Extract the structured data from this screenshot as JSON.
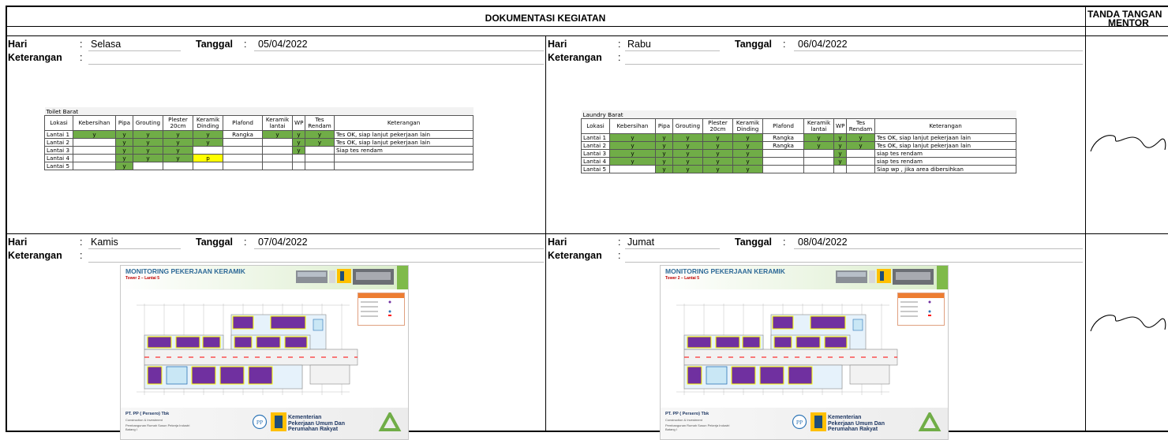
{
  "header": {
    "dokumentasi": "DOKUMENTASI KEGIATAN",
    "tanda_tangan": "TANDA TANGAN",
    "mentor": "MENTOR"
  },
  "labels": {
    "hari": "Hari",
    "tanggal": "Tanggal",
    "keterangan": "Keterangan",
    "colon": ":"
  },
  "entries": [
    {
      "hari": "Selasa",
      "tanggal": "05/04/2022"
    },
    {
      "hari": "Rabu",
      "tanggal": "06/04/2022"
    },
    {
      "hari": "Kamis",
      "tanggal": "07/04/2022"
    },
    {
      "hari": "Jumat",
      "tanggal": "08/04/2022"
    }
  ],
  "table_headers": [
    "Lokasi",
    "Kebersihan",
    "Pipa",
    "Grouting",
    "Plester 20cm",
    "Keramik Dinding",
    "Plafond",
    "Keramik lantai",
    "WP",
    "Tes Rendam",
    "Keterangan"
  ],
  "table1": {
    "title": "Toilet Barat",
    "rows": [
      {
        "cells": [
          "Lantai 1",
          "y",
          "y",
          "y",
          "y",
          "y",
          "Rangka",
          "y",
          "y",
          "y",
          "Tes OK, siap lanjut pekerjaan lain"
        ]
      },
      {
        "cells": [
          "Lantai 2",
          "",
          "y",
          "y",
          "y",
          "y",
          "",
          "",
          "y",
          "y",
          "Tes OK, siap lanjut pekerjaan lain"
        ]
      },
      {
        "cells": [
          "Lantai 3",
          "",
          "y",
          "y",
          "y",
          "",
          "",
          "",
          "y",
          "",
          "Siap tes rendam"
        ]
      },
      {
        "cells": [
          "Lantai 4",
          "",
          "y",
          "y",
          "y",
          "p",
          "",
          "",
          "",
          "",
          ""
        ]
      },
      {
        "cells": [
          "Lantai 5",
          "",
          "y",
          "",
          "",
          "",
          "",
          "",
          "",
          "",
          ""
        ]
      }
    ]
  },
  "table2": {
    "title": "Laundry Barat",
    "rows": [
      {
        "cells": [
          "Lantai 1",
          "y",
          "y",
          "y",
          "y",
          "y",
          "Rangka",
          "y",
          "y",
          "y",
          "Tes OK, siap lanjut pekerjaan lain"
        ]
      },
      {
        "cells": [
          "Lantai 2",
          "y",
          "y",
          "y",
          "y",
          "y",
          "Rangka",
          "y",
          "y",
          "y",
          "Tes OK, siap lanjut pekerjaan lain"
        ]
      },
      {
        "cells": [
          "Lantai 3",
          "y",
          "y",
          "y",
          "y",
          "y",
          "",
          "",
          "y",
          "",
          "siap tes rendam"
        ]
      },
      {
        "cells": [
          "Lantai 4",
          "y",
          "y",
          "y",
          "y",
          "y",
          "",
          "",
          "y",
          "",
          "siap tes rendam"
        ]
      },
      {
        "cells": [
          "Lantai 5",
          "",
          "y",
          "y",
          "y",
          "y",
          "",
          "",
          "",
          "",
          "Siap wp , jika area dibersihkan"
        ]
      }
    ]
  },
  "monitoring": {
    "title": "MONITORING PEKERJAAN KERAMIK",
    "subtitle": "Tower 2 – Lantai 5",
    "company": "PT. PP ( Persero) Tbk",
    "company_sub": "Construction & Investment",
    "project": "Pembangunan Rumah Susun Pekerja Industri Batang I",
    "ministry": [
      "Kementerian",
      "Pekerjaan Umum Dan",
      "Perumahan Rakyat"
    ],
    "pp_logo": "PP"
  },
  "colors": {
    "green": "#70ad47",
    "yellow": "#ffff00",
    "purple": "#7030a0",
    "grid": "#000000"
  }
}
